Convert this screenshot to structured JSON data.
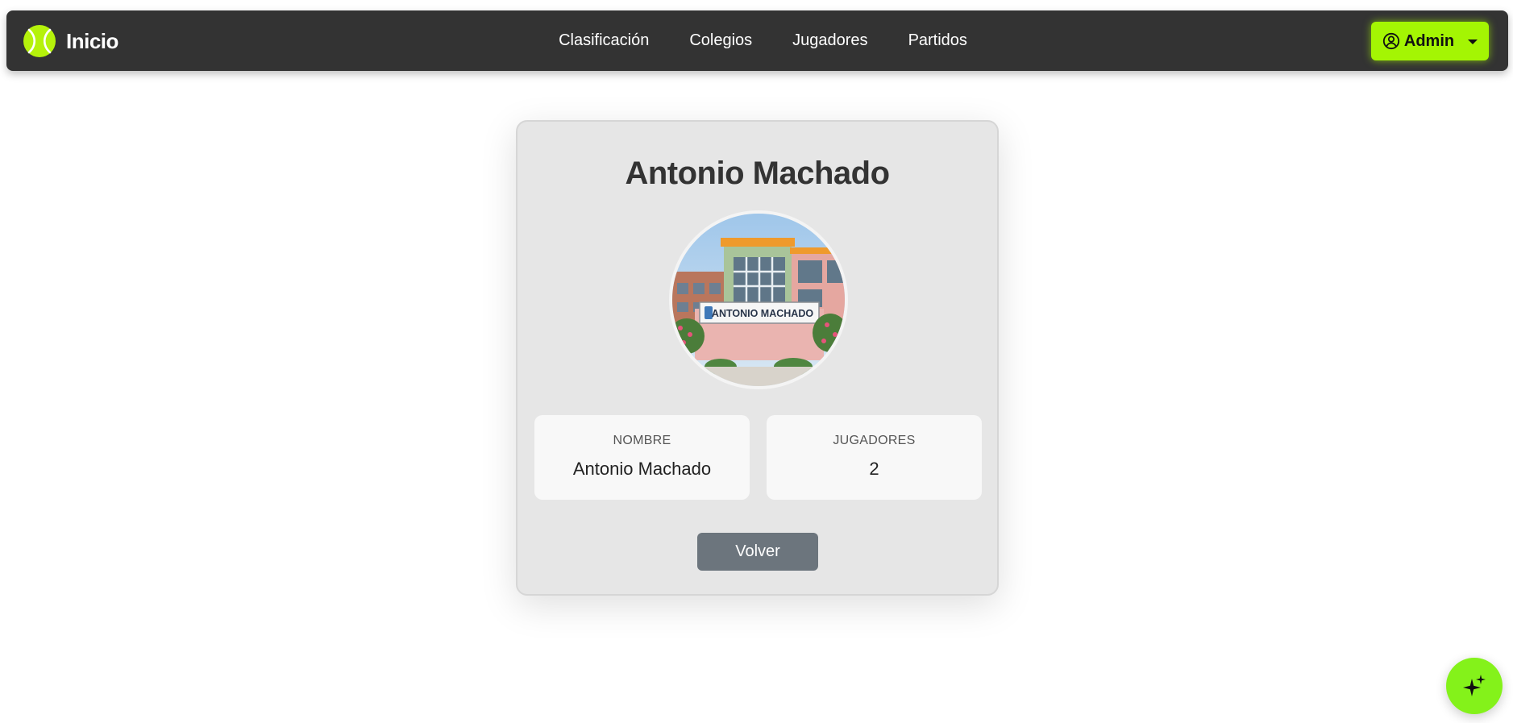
{
  "navbar": {
    "brand": "Inicio",
    "links": [
      "Clasificación",
      "Colegios",
      "Jugadores",
      "Partidos"
    ],
    "user_menu_label": "Admin"
  },
  "icons": {
    "brand": "tennis-ball-icon",
    "user": "user-circle-icon",
    "caret": "caret-down-icon",
    "fab": "sparkles-icon"
  },
  "colors": {
    "navbar_bg": "#333333",
    "accent": "#a4f503",
    "fab": "#84f21a",
    "card_bg": "#e6e6e6",
    "back_button": "#6c757d"
  },
  "school": {
    "title": "Antonio Machado",
    "photo_sign_text": "ANTONIO MACHADO",
    "fields": [
      {
        "label": "NOMBRE",
        "value": "Antonio Machado"
      },
      {
        "label": "JUGADORES",
        "value": "2"
      }
    ],
    "back_label": "Volver"
  }
}
